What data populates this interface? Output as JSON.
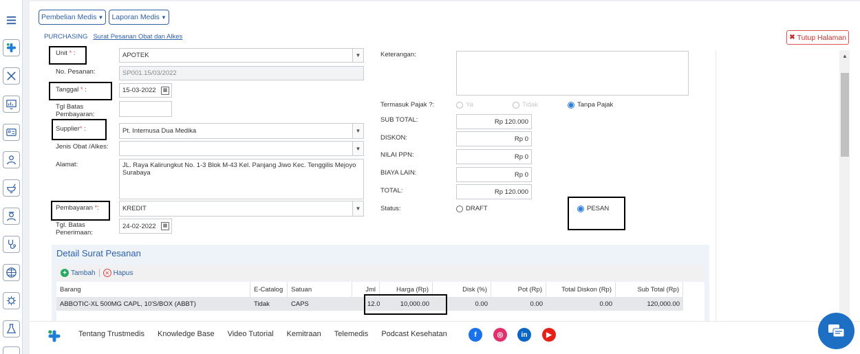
{
  "colors": {
    "accent": "#2d5fa8",
    "danger": "#d9534f",
    "radio_on": "#2d7fe0"
  },
  "sidebar": {
    "icons": [
      "menu-icon",
      "trustmedis-logo-icon",
      "tools-icon",
      "monitor-chart-icon",
      "id-card-icon",
      "user-icon",
      "mortar-pestle-icon",
      "nurse-icon",
      "stethoscope-icon",
      "globe-icon",
      "virus-icon",
      "flask-icon",
      "printer-icon"
    ]
  },
  "topmenu": {
    "pembelian": "Pembelian Medis",
    "laporan": "Laporan Medis"
  },
  "breadcrumb": {
    "root": "PURCHASING",
    "current": "Surat Pesanan Obat dan Alkes"
  },
  "close_label": "Tutup Halaman",
  "form": {
    "unit_label": "Unit",
    "unit_value": "APOTEK",
    "no_pesanan_label": "No. Pesanan:",
    "no_pesanan_value": "SP001.15/03/2022",
    "tanggal_label": "Tanggal",
    "tanggal_value": "15-03-2022",
    "tgl_batas_bayar_label": "Tgl Batas Pembayaran:",
    "tgl_batas_bayar_value": "",
    "supplier_label": "Supplier",
    "supplier_value": "Pt. Internusa Dua  Medika",
    "jenis_label": "Jenis Obat /Alkes:",
    "jenis_value": "",
    "alamat_label": "Alamat:",
    "alamat_value": "JL. Raya Kalirungkut No. 1-3 Blok M-43 Kel. Panjang Jiwo Kec. Tenggilis Mejoyo Surabaya",
    "pembayaran_label": "Pembayaran",
    "pembayaran_value": "KREDIT",
    "tgl_penerimaan_label": "Tgl. Batas Penerimaan:",
    "tgl_penerimaan_value": "24-02-2022",
    "keterangan_label": "Keterangan:",
    "keterangan_value": "",
    "pajak_label": "Termasuk Pajak ?:",
    "pajak_ya": "Ya",
    "pajak_tidak": "Tidak",
    "pajak_tanpa": "Tanpa Pajak",
    "subtotal_label": "SUB TOTAL:",
    "subtotal_value": "Rp 120.000",
    "diskon_label": "DISKON:",
    "diskon_value": "Rp 0",
    "ppn_label": "NILAI PPN:",
    "ppn_value": "Rp 0",
    "biaya_label": "BIAYA LAIN:",
    "biaya_value": "Rp 0",
    "total_label": "TOTAL:",
    "total_value": "Rp 120.000",
    "status_label": "Status:",
    "status_draft": "DRAFT",
    "status_pesan": "PESAN",
    "selected_status": "PESAN",
    "selected_pajak": "Tanpa Pajak"
  },
  "detail": {
    "title": "Detail Surat Pesanan",
    "tambah": "Tambah",
    "hapus": "Hapus",
    "columns": [
      "Barang",
      "E-Catalog",
      "Satuan",
      "Jml",
      "Harga (Rp)",
      "Disk (%)",
      "Pot (Rp)",
      "Total Diskon (Rp)",
      "Sub Total (Rp)"
    ],
    "rows": [
      [
        "ABBOTIC-XL 500MG CAPL, 10'S/BOX (ABBT)",
        "Tidak",
        "CAPS",
        "12.00",
        "10,000.00",
        "0.00",
        "0.00",
        "0.00",
        "120,000.00"
      ]
    ]
  },
  "footer": {
    "links": [
      "Tentang Trustmedis",
      "Knowledge Base",
      "Video Tutorial",
      "Kemitraan",
      "Telemedis",
      "Podcast Kesehatan"
    ],
    "social": [
      "facebook-icon",
      "instagram-icon",
      "linkedin-icon",
      "youtube-icon"
    ]
  }
}
